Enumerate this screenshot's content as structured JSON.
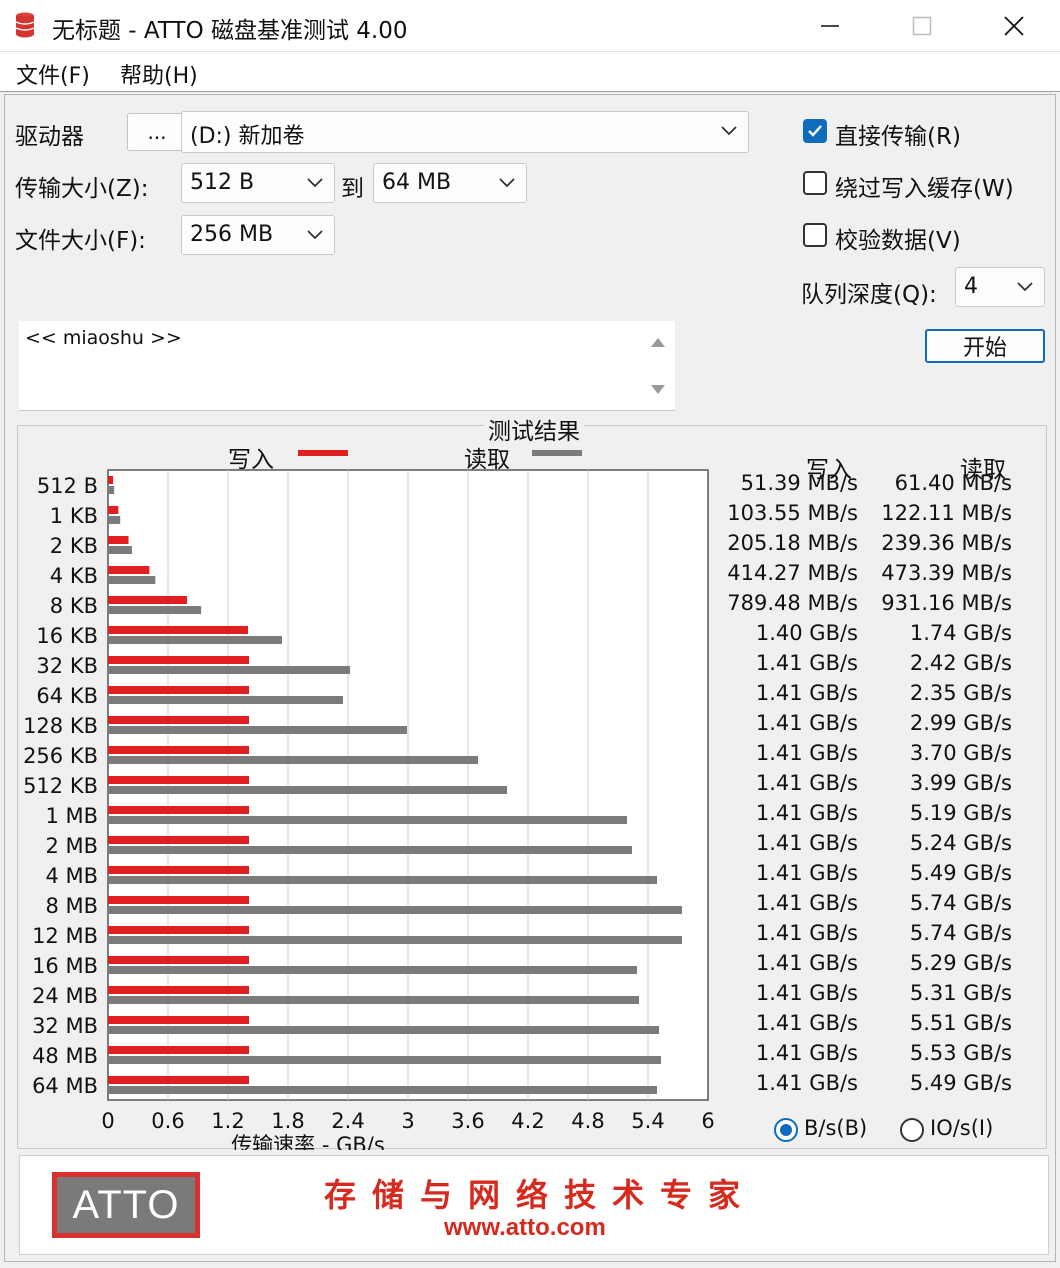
{
  "window": {
    "title": "无标题 - ATTO 磁盘基准测试 4.00",
    "icon": "database-icon",
    "controls": [
      "minimize-icon",
      "maximize-icon",
      "close-icon"
    ]
  },
  "menu": {
    "file": "文件(F)",
    "help": "帮助(H)"
  },
  "form": {
    "drive_label": "驱动器",
    "browse_label": "...",
    "drive_value": "(D:) 新加卷",
    "transfer_label": "传输大小(Z):",
    "transfer_from": "512 B",
    "to_label": "到",
    "transfer_to": "64 MB",
    "file_size_label": "文件大小(F):",
    "file_size": "256 MB",
    "direct_io": {
      "label": "直接传输(R)",
      "checked": true
    },
    "bypass_cache": {
      "label": "绕过写入缓存(W)",
      "checked": false
    },
    "verify": {
      "label": "校验数据(V)",
      "checked": false
    },
    "queue_label": "队列深度(Q):",
    "queue_value": "4",
    "start_label": "开始",
    "description": "<< miaoshu >>"
  },
  "results": {
    "title": "测试结果",
    "legend_write": "写入",
    "legend_read": "读取",
    "col_write": "写入",
    "col_read": "读取",
    "unit_bytes": "B/s(B)",
    "unit_io": "IO/s(I)",
    "unit_selected": "B/s",
    "rows": [
      {
        "size": "512 B",
        "write": "51.39 MB/s",
        "read": "61.40 MB/s"
      },
      {
        "size": "1 KB",
        "write": "103.55 MB/s",
        "read": "122.11 MB/s"
      },
      {
        "size": "2 KB",
        "write": "205.18 MB/s",
        "read": "239.36 MB/s"
      },
      {
        "size": "4 KB",
        "write": "414.27 MB/s",
        "read": "473.39 MB/s"
      },
      {
        "size": "8 KB",
        "write": "789.48 MB/s",
        "read": "931.16 MB/s"
      },
      {
        "size": "16 KB",
        "write": "1.40 GB/s",
        "read": "1.74 GB/s"
      },
      {
        "size": "32 KB",
        "write": "1.41 GB/s",
        "read": "2.42 GB/s"
      },
      {
        "size": "64 KB",
        "write": "1.41 GB/s",
        "read": "2.35 GB/s"
      },
      {
        "size": "128 KB",
        "write": "1.41 GB/s",
        "read": "2.99 GB/s"
      },
      {
        "size": "256 KB",
        "write": "1.41 GB/s",
        "read": "3.70 GB/s"
      },
      {
        "size": "512 KB",
        "write": "1.41 GB/s",
        "read": "3.99 GB/s"
      },
      {
        "size": "1 MB",
        "write": "1.41 GB/s",
        "read": "5.19 GB/s"
      },
      {
        "size": "2 MB",
        "write": "1.41 GB/s",
        "read": "5.24 GB/s"
      },
      {
        "size": "4 MB",
        "write": "1.41 GB/s",
        "read": "5.49 GB/s"
      },
      {
        "size": "8 MB",
        "write": "1.41 GB/s",
        "read": "5.74 GB/s"
      },
      {
        "size": "12 MB",
        "write": "1.41 GB/s",
        "read": "5.74 GB/s"
      },
      {
        "size": "16 MB",
        "write": "1.41 GB/s",
        "read": "5.29 GB/s"
      },
      {
        "size": "24 MB",
        "write": "1.41 GB/s",
        "read": "5.31 GB/s"
      },
      {
        "size": "32 MB",
        "write": "1.41 GB/s",
        "read": "5.51 GB/s"
      },
      {
        "size": "48 MB",
        "write": "1.41 GB/s",
        "read": "5.53 GB/s"
      },
      {
        "size": "64 MB",
        "write": "1.41 GB/s",
        "read": "5.49 GB/s"
      }
    ]
  },
  "chart_data": {
    "type": "bar",
    "orientation": "horizontal",
    "title": "测试结果",
    "xlabel": "传输速率 - GB/s",
    "ylabel": "",
    "xlim": [
      0,
      6
    ],
    "x_ticks": [
      "0",
      "0.6",
      "1.2",
      "1.8",
      "2.4",
      "3",
      "3.6",
      "4.2",
      "4.8",
      "5.4",
      "6"
    ],
    "grid": true,
    "legend": "top",
    "categories": [
      "512 B",
      "1 KB",
      "2 KB",
      "4 KB",
      "8 KB",
      "16 KB",
      "32 KB",
      "64 KB",
      "128 KB",
      "256 KB",
      "512 KB",
      "1 MB",
      "2 MB",
      "4 MB",
      "8 MB",
      "12 MB",
      "16 MB",
      "24 MB",
      "32 MB",
      "48 MB",
      "64 MB"
    ],
    "series": [
      {
        "name": "写入",
        "color": "#e02020",
        "values": [
          0.05139,
          0.10355,
          0.20518,
          0.41427,
          0.78948,
          1.4,
          1.41,
          1.41,
          1.41,
          1.41,
          1.41,
          1.41,
          1.41,
          1.41,
          1.41,
          1.41,
          1.41,
          1.41,
          1.41,
          1.41,
          1.41
        ]
      },
      {
        "name": "读取",
        "color": "#7b7b7b",
        "values": [
          0.0614,
          0.12211,
          0.23936,
          0.47339,
          0.93116,
          1.74,
          2.42,
          2.35,
          2.99,
          3.7,
          3.99,
          5.19,
          5.24,
          5.49,
          5.74,
          5.74,
          5.29,
          5.31,
          5.51,
          5.53,
          5.49
        ]
      }
    ]
  },
  "banner": {
    "logo": "ATTO",
    "slogan": "存储与网络技术专家",
    "url": "www.atto.com"
  }
}
